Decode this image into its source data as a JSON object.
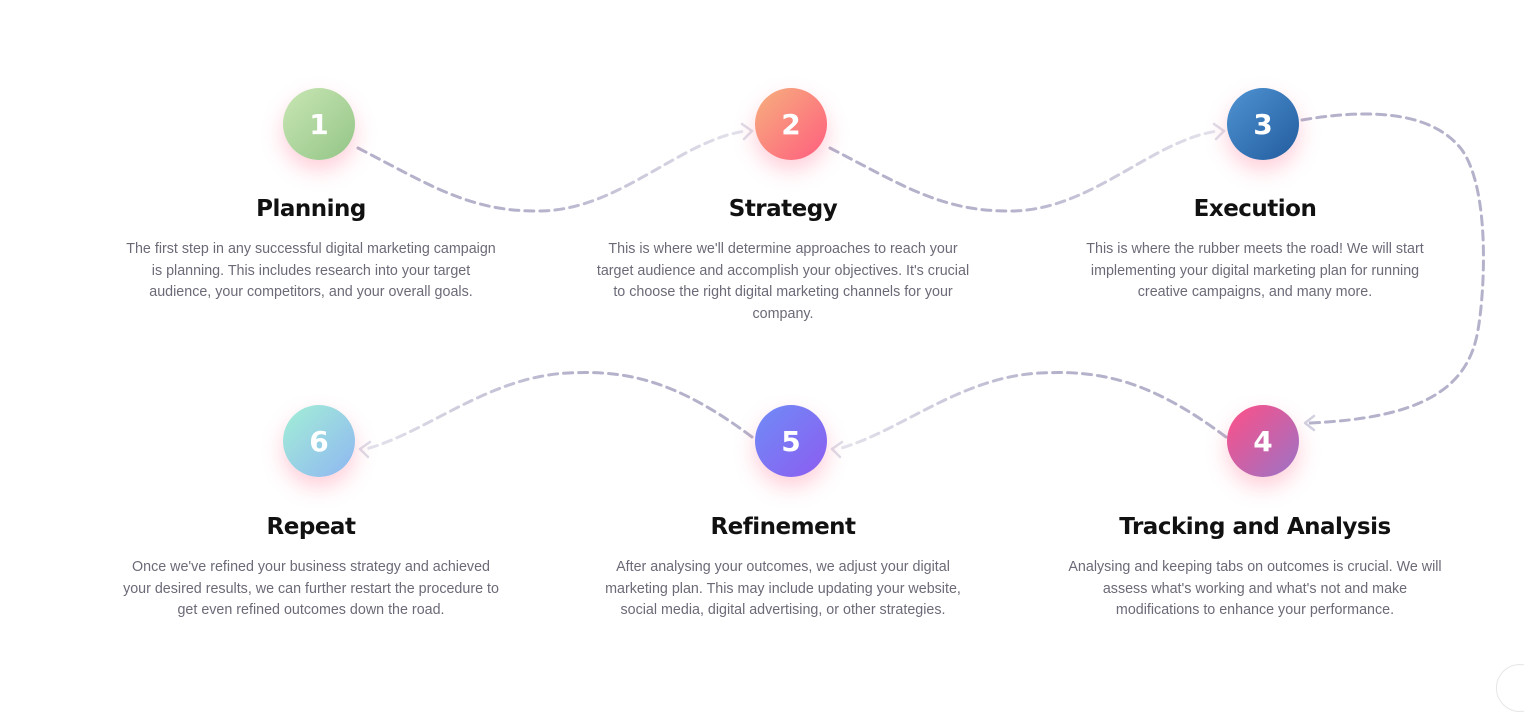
{
  "steps": [
    {
      "number": "1",
      "title": "Planning",
      "description": "The first step in any successful digital marketing campaign is planning. This includes research into your target audience, your competitors, and your overall goals.",
      "gradient": [
        "#c9e6b4",
        "#93c587"
      ]
    },
    {
      "number": "2",
      "title": "Strategy",
      "description": "This is where we'll determine approaches to reach your target audience and accomplish your objectives. It's crucial to choose the right digital marketing channels for your company.",
      "gradient": [
        "#f6b07e",
        "#ff5d7e"
      ]
    },
    {
      "number": "3",
      "title": "Execution",
      "description": "This is where the rubber meets the road! We will start implementing your digital marketing plan for running creative campaigns, and many more.",
      "gradient": [
        "#4f93d2",
        "#225c9e"
      ]
    },
    {
      "number": "4",
      "title": "Tracking and Analysis",
      "description": "Analysing and keeping tabs on outcomes is crucial. We will assess what's working and what's not and make modifications to enhance your performance.",
      "gradient": [
        "#ff4f86",
        "#9a73c7"
      ]
    },
    {
      "number": "5",
      "title": "Refinement",
      "description": "After analysing your outcomes, we adjust your digital marketing plan. This may include updating your website, social media, digital advertising, or other strategies.",
      "gradient": [
        "#6f8cf7",
        "#8c5cf0"
      ]
    },
    {
      "number": "6",
      "title": "Repeat",
      "description": "Once we've refined your business strategy and achieved your desired results, we can further restart the procedure to get even refined outcomes down the road.",
      "gradient": [
        "#a3efd6",
        "#8fb6f2"
      ]
    }
  ],
  "connector_color": "#b4b2cb"
}
